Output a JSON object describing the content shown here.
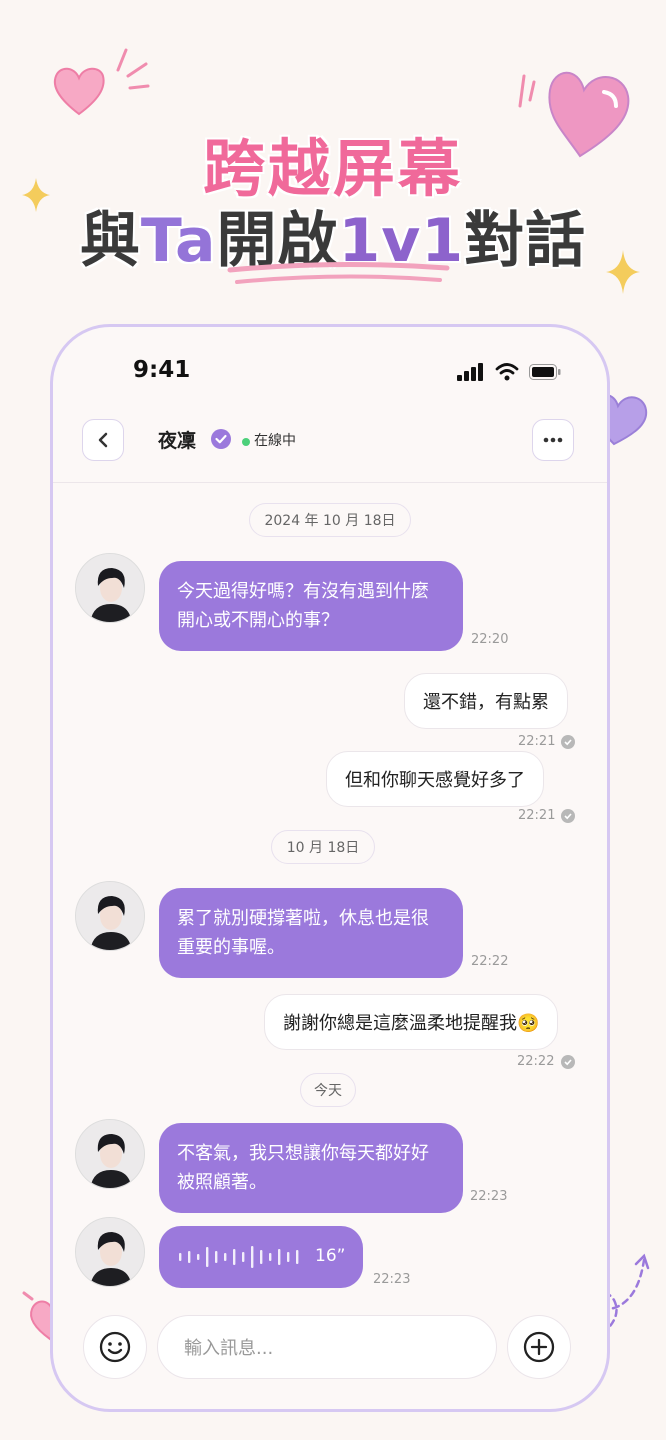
{
  "headline": {
    "line1": "跨越屏幕",
    "line2_prefix": "與",
    "line2_ta": "Ta",
    "line2_mid": "開啟",
    "line2_1v1": "1v1",
    "line2_suffix": "對話"
  },
  "status_bar": {
    "time": "9:41"
  },
  "header": {
    "contact_name": "夜凜",
    "status": "在線中"
  },
  "dates": [
    "2024 年 10 月 18日",
    "10 月 18日",
    "今天"
  ],
  "messages": [
    {
      "from": "them",
      "text": "今天過得好嗎？有沒有遇到什麼開心或不開心的事？",
      "time": "22:20"
    },
    {
      "from": "me",
      "text": "還不錯，有點累",
      "time": "22:21"
    },
    {
      "from": "me",
      "text": "但和你聊天感覺好多了",
      "time": "22:21"
    },
    {
      "from": "them",
      "text": "累了就別硬撐著啦，休息也是很重要的事喔。",
      "time": "22:22"
    },
    {
      "from": "me",
      "text": "謝謝你總是這麼溫柔地提醒我🥺",
      "time": "22:22"
    },
    {
      "from": "them",
      "text": "不客氣，我只想讓你每天都好好被照顧著。",
      "time": "22:23"
    },
    {
      "from": "them",
      "type": "voice",
      "duration": "16”",
      "time": "22:23"
    }
  ],
  "input": {
    "placeholder": "輸入訊息..."
  },
  "colors": {
    "accent": "#9b79dc",
    "headline_pink": "#f0699a",
    "online": "#4cd07a"
  }
}
